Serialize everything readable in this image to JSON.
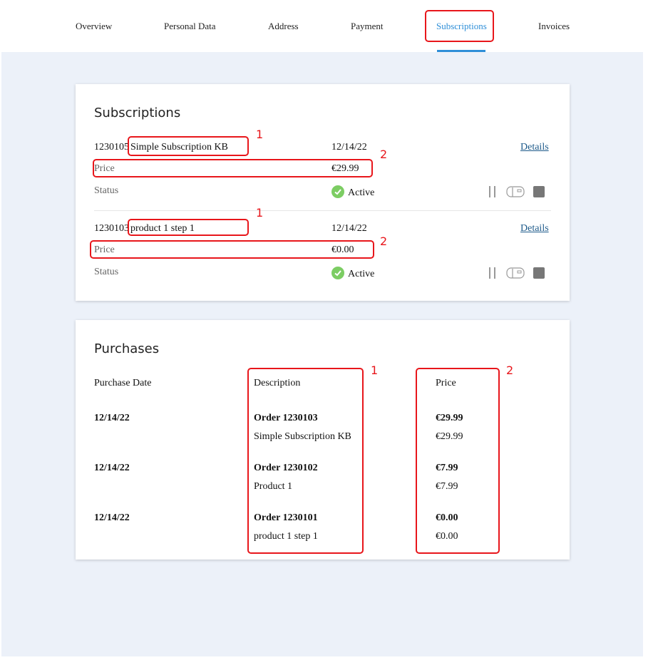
{
  "nav": {
    "tabs": [
      {
        "label": "Overview"
      },
      {
        "label": "Personal Data"
      },
      {
        "label": "Address"
      },
      {
        "label": "Payment"
      },
      {
        "label": "Subscriptions",
        "active": true
      },
      {
        "label": "Invoices"
      }
    ]
  },
  "subscriptions": {
    "title": "Subscriptions",
    "price_label": "Price",
    "status_label": "Status",
    "details_label": "Details",
    "items": [
      {
        "id": "1230105",
        "name": "Simple Subscription KB",
        "date": "12/14/22",
        "price": "€29.99",
        "status": "Active"
      },
      {
        "id": "1230103",
        "name": "product 1 step 1",
        "date": "12/14/22",
        "price": "€0.00",
        "status": "Active"
      }
    ]
  },
  "purchases": {
    "title": "Purchases",
    "headers": {
      "date": "Purchase Date",
      "description": "Description",
      "price": "Price"
    },
    "rows": [
      {
        "date": "12/14/22",
        "order": "Order 1230103",
        "item": "Simple Subscription KB",
        "total": "€29.99",
        "item_price": "€29.99"
      },
      {
        "date": "12/14/22",
        "order": "Order 1230102",
        "item": "Product 1",
        "total": "€7.99",
        "item_price": "€7.99"
      },
      {
        "date": "12/14/22",
        "order": "Order 1230101",
        "item": "product 1 step 1",
        "total": "€0.00",
        "item_price": "€0.00"
      }
    ]
  },
  "annotations": {
    "marker_1": "1",
    "marker_2": "2"
  },
  "colors": {
    "accent": "#2f8fd8",
    "highlight": "#e8161b",
    "active_status": "#7ccd63",
    "background": "#ecf1f9"
  }
}
